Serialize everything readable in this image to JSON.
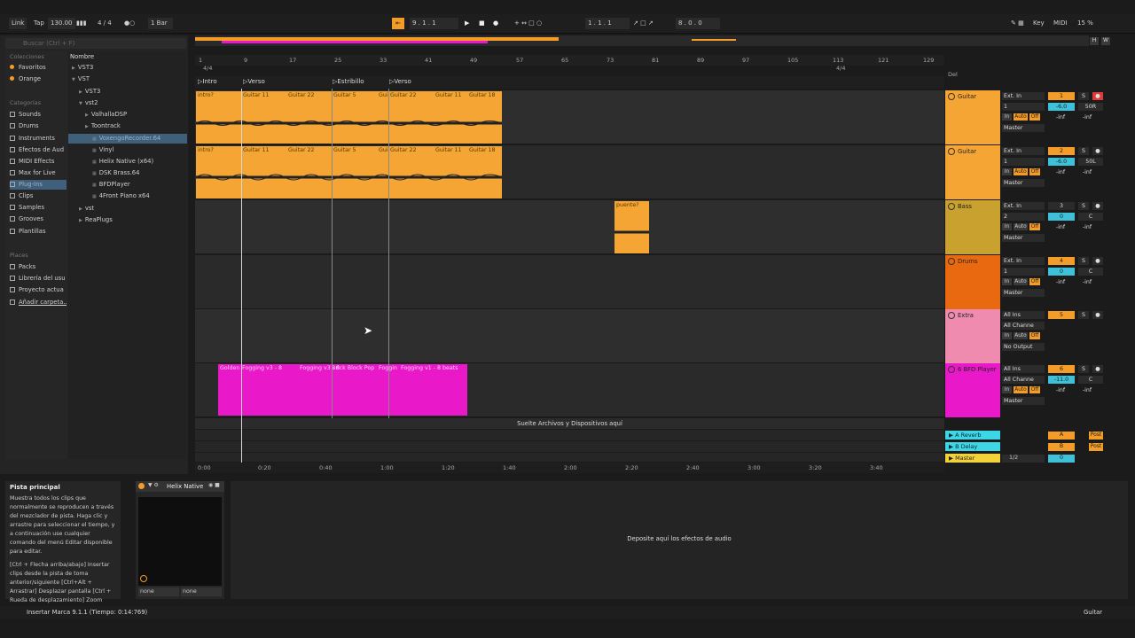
{
  "transport": {
    "link": "Link",
    "tap": "Tap",
    "tempo": "130.00",
    "signature": "4 / 4",
    "quantize": "1 Bar",
    "position": "9 .  1 .  1",
    "loop_start": "1 .  1 .  1",
    "loop_length": "8 .  0 .  0",
    "key": "Key",
    "midi": "MIDI",
    "cpu": "15 %"
  },
  "browser": {
    "search_placeholder": "Buscar (Ctrl + F)",
    "collections_header": "Colecciones",
    "collections": [
      {
        "label": "Favoritos",
        "color": "#f39c27"
      },
      {
        "label": "Orange",
        "color": "#f39c27"
      }
    ],
    "categories_header": "Categorías",
    "categories": [
      "Sounds",
      "Drums",
      "Instruments",
      "Efectos de Aud",
      "MIDI Effects",
      "Max for Live",
      "Plug-Ins",
      "Clips",
      "Samples",
      "Grooves",
      "Plantillas"
    ],
    "places_header": "Places",
    "places": [
      "Packs",
      "Librería del usu",
      "Proyecto actua",
      "Añadir carpeta..."
    ],
    "name_header": "Nombre",
    "files": [
      {
        "label": "VST3",
        "indent": 0
      },
      {
        "label": "VST",
        "indent": 0
      },
      {
        "label": "VST3",
        "indent": 1
      },
      {
        "label": "vst2",
        "indent": 1
      },
      {
        "label": "ValhallaDSP",
        "indent": 2
      },
      {
        "label": "Toontrack",
        "indent": 2
      },
      {
        "label": "VoxengoRecorder.64",
        "indent": 3
      },
      {
        "label": "Vinyl",
        "indent": 3
      },
      {
        "label": "Helix Native (x64)",
        "indent": 3
      },
      {
        "label": "DSK Brass.64",
        "indent": 3
      },
      {
        "label": "BFDPlayer",
        "indent": 3
      },
      {
        "label": "4Front Piano x64",
        "indent": 3
      },
      {
        "label": "vst",
        "indent": 1
      },
      {
        "label": "ReaPlugs",
        "indent": 1
      }
    ]
  },
  "ruler": {
    "signature_marks": [
      "4/4",
      "4/4"
    ],
    "bars": [
      "1",
      "9",
      "17",
      "25",
      "33",
      "41",
      "49",
      "57",
      "65",
      "73",
      "81",
      "89",
      "97",
      "105",
      "113",
      "121",
      "129"
    ]
  },
  "locators": [
    "Intro",
    "Verso",
    "Estribillo",
    "Verso"
  ],
  "clip_names_guitar": [
    "intro?",
    "Guitar 11",
    "Guitar 22",
    "Guitar 5",
    "Gui",
    "Guitar 22",
    "Guitar 11",
    "Guitar 18"
  ],
  "bass_clip": "puente?",
  "bfd_clips": [
    "Golden",
    "Fogging v3 - 8",
    "Fogging v3 - 8",
    "Brick Block Pop",
    "Foggin",
    "Fogging v1 - 8 beats"
  ],
  "drop_files_text": "Suelte Archivos y Dispositivos aquí",
  "del_label": "Del",
  "tracks": [
    {
      "name": "Guitar",
      "color": "#f5a533",
      "input": "Ext. In",
      "channel": "1",
      "monitor": [
        "In",
        "Auto",
        "Off"
      ],
      "output": "Master",
      "number": "1",
      "volume": "-6.0",
      "pan": "50R",
      "peak_l": "-inf",
      "peak_r": "-inf"
    },
    {
      "name": "Guitar",
      "color": "#f5a533",
      "input": "Ext. In",
      "channel": "1",
      "monitor": [
        "In",
        "Auto",
        "Off"
      ],
      "output": "Master",
      "number": "2",
      "volume": "-6.0",
      "pan": "50L",
      "peak_l": "-inf",
      "peak_r": "-inf"
    },
    {
      "name": "Bass",
      "color": "#c9a12e",
      "input": "Ext. In",
      "channel": "2",
      "monitor": [
        "In",
        "Auto",
        "Off"
      ],
      "output": "Master",
      "number": "3",
      "volume": "0",
      "pan": "C",
      "peak_l": "-inf",
      "peak_r": "-inf"
    },
    {
      "name": "Drums",
      "color": "#e8690f",
      "input": "Ext. In",
      "channel": "1",
      "monitor": [
        "In",
        "Auto",
        "Off"
      ],
      "output": "Master",
      "number": "4",
      "volume": "0",
      "pan": "C",
      "peak_l": "-inf",
      "peak_r": "-inf"
    },
    {
      "name": "Extra",
      "color": "#f08bb0",
      "input": "All Ins",
      "channel": "All Channe",
      "monitor": [
        "In",
        "Auto",
        "Off"
      ],
      "output": "No Output",
      "number": "5",
      "volume": "",
      "pan": "",
      "peak_l": "",
      "peak_r": ""
    },
    {
      "name": "6 BFD Player",
      "color": "#e918c8",
      "input": "All Ins",
      "channel": "All Channe",
      "monitor": [
        "In",
        "Auto",
        "Off"
      ],
      "output": "Master",
      "number": "6",
      "volume": "-11.0",
      "pan": "C",
      "peak_l": "-inf",
      "peak_r": "-inf"
    }
  ],
  "returns": [
    {
      "name": "A Reverb",
      "letter": "A",
      "send": "Post",
      "color": "#3dd6e6"
    },
    {
      "name": "B Delay",
      "letter": "B",
      "send": "Post",
      "color": "#3dd6e6"
    },
    {
      "name": "Master",
      "letter": "1/2",
      "send": "0",
      "color": "#f2d23a"
    }
  ],
  "time_marks": [
    "0:00",
    "0:20",
    "0:40",
    "1:00",
    "1:20",
    "1:40",
    "2:00",
    "2:20",
    "2:40",
    "3:00",
    "3:20",
    "3:40"
  ],
  "info": {
    "title": "Pista principal",
    "body": "Muestra todos los clips que normalmente se reproducen a través del mezclador de pista. Haga clic y arrastre para seleccionar el tiempo, y a continuación use cualquier comando del menú Editar disponible para editar.",
    "shortcuts": "[Ctrl + Flecha arriba/abajo] Insertar clips desde la pista de toma anterior/siguiente [Ctrl+Alt + Arrastrar] Desplazar pantalla [Ctrl + Rueda de desplazamiento] Zoom In/Out"
  },
  "device": {
    "name": "Helix Native",
    "sel1": "none",
    "sel2": "none"
  },
  "fx_drop_text": "Deposite aquí los efectos de audio",
  "status": {
    "message": "Insertar Marca 9.1.1 (Tiempo: 0:14:769)",
    "track": "Guitar"
  }
}
